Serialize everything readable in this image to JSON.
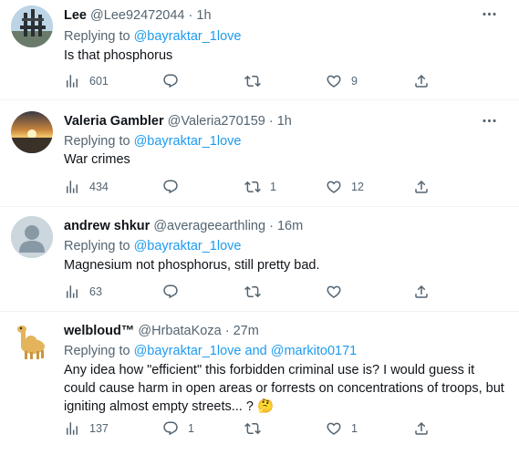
{
  "replying_to_prefix": "Replying to",
  "tweets": [
    {
      "name": "Lee",
      "handle": "@Lee92472044",
      "sep": "·",
      "time": "1h",
      "replying_to": "@bayraktar_1love",
      "replying_and": "",
      "replying_to_2": "",
      "text": "Is that phosphorus",
      "views": "601",
      "replies": "",
      "retweets": "",
      "likes": "9"
    },
    {
      "name": "Valeria Gambler",
      "handle": "@Valeria270159",
      "sep": "·",
      "time": "1h",
      "replying_to": "@bayraktar_1love",
      "replying_and": "",
      "replying_to_2": "",
      "text": "War crimes",
      "views": "434",
      "replies": "",
      "retweets": "1",
      "likes": "12"
    },
    {
      "name": "andrew shkur",
      "handle": "@averageearthling",
      "sep": "·",
      "time": "16m",
      "replying_to": "@bayraktar_1love",
      "replying_and": "",
      "replying_to_2": "",
      "text": "Magnesium not phosphorus, still pretty bad.",
      "views": "63",
      "replies": "",
      "retweets": "",
      "likes": ""
    },
    {
      "name": "welbloud™",
      "handle": "@HrbataKoza",
      "sep": "·",
      "time": "27m",
      "replying_to": "@bayraktar_1love",
      "replying_and": "and",
      "replying_to_2": "@markito0171",
      "text_lines": [
        "Any idea how \"efficient\" this forbidden criminal use is? I would guess it",
        "could cause harm in open areas or forrests on concentrations of troops, but",
        "igniting almost empty streets... ? 🤔"
      ],
      "views": "137",
      "replies": "1",
      "retweets": "",
      "likes": "1"
    }
  ],
  "icons": {
    "views": "bar-chart-icon",
    "reply": "speech-bubble-icon",
    "retweet": "retweet-icon",
    "like": "heart-icon",
    "share": "share-icon",
    "more": "more-dots-icon"
  },
  "colors": {
    "text": "#0f1419",
    "secondary": "#536471",
    "link": "#1d9bf0",
    "divider": "#eff3f4"
  }
}
